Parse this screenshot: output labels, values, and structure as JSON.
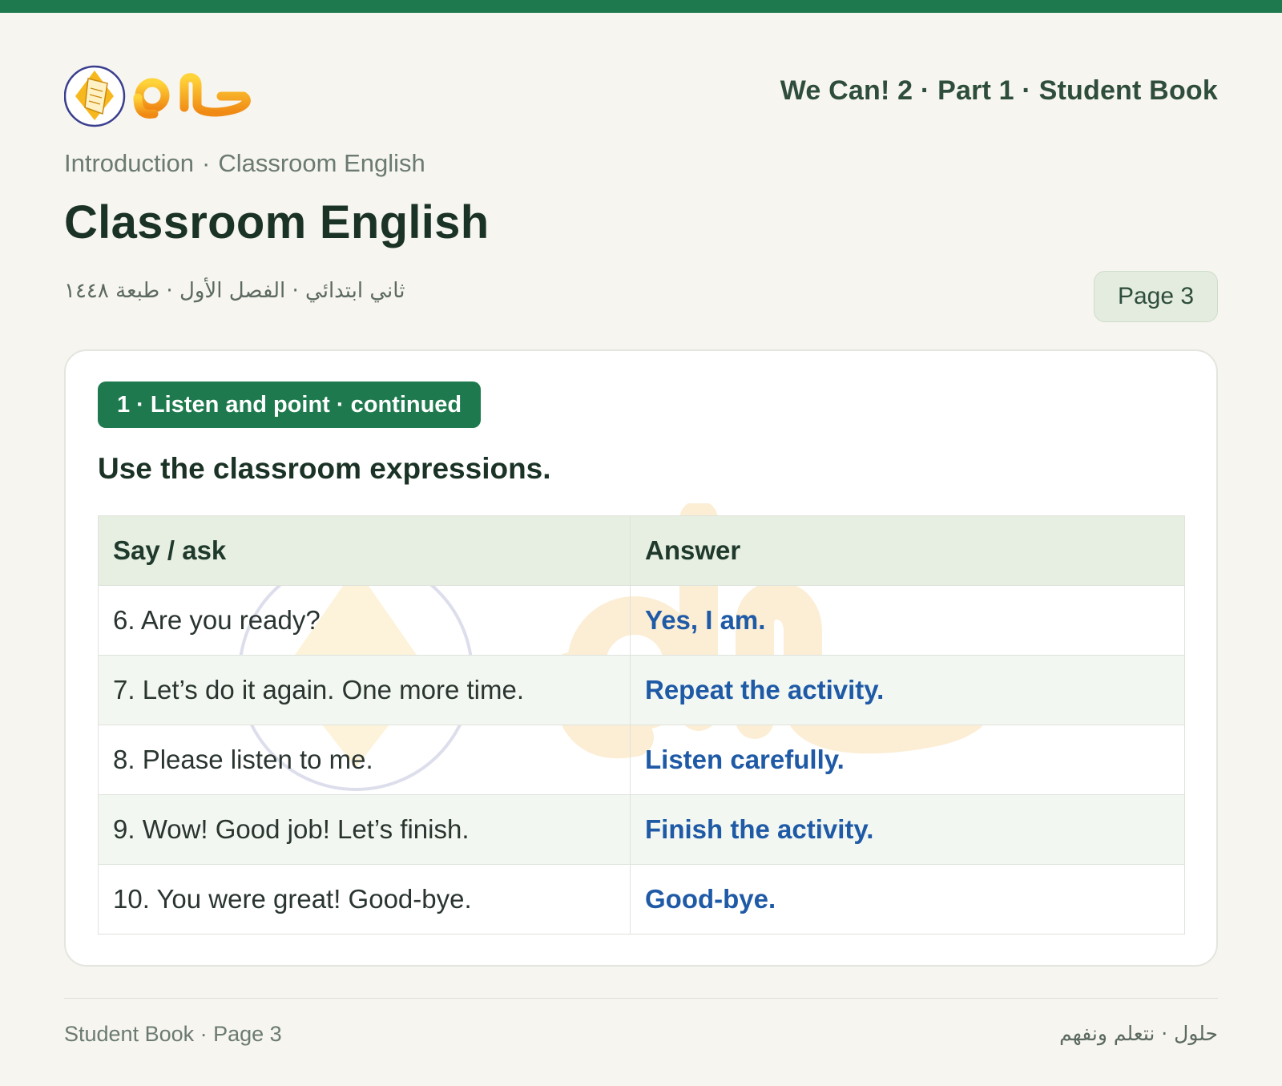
{
  "header": {
    "logo_text": "حلول",
    "book_title": "We Can! 2 · Part 1 · Student Book",
    "breadcrumb": [
      "Introduction",
      "Classroom English"
    ],
    "breadcrumb_sep": "·",
    "page_title": "Classroom English",
    "meta_ar": "ثاني ابتدائي · الفصل الأول · طبعة ١٤٤٨",
    "page_badge": "Page 3"
  },
  "section": {
    "pill": "1 · Listen and point · continued",
    "instruction": "Use the classroom expressions."
  },
  "table": {
    "headers": [
      "Say / ask",
      "Answer"
    ],
    "rows": [
      {
        "say": "6. Are you ready?",
        "answer": "Yes, I am."
      },
      {
        "say": "7. Let’s do it again. One more time.",
        "answer": "Repeat the activity."
      },
      {
        "say": "8. Please listen to me.",
        "answer": "Listen carefully."
      },
      {
        "say": "9. Wow! Good job! Let’s finish.",
        "answer": "Finish the activity."
      },
      {
        "say": "10. You were great! Good-bye.",
        "answer": "Good-bye."
      }
    ]
  },
  "footer": {
    "left": "Student Book · Page 3",
    "right": "حلول · نتعلم ونفهم"
  },
  "colors": {
    "brand_green": "#1e7a4e",
    "answer_blue": "#1f5aa6",
    "logo_orange": "#f0a21e"
  },
  "icons": {
    "logo": "book-in-circle-icon"
  }
}
